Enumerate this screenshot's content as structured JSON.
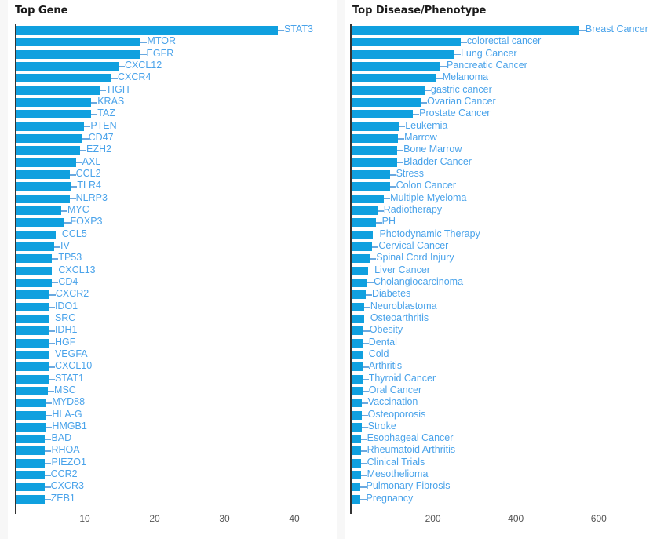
{
  "page": {
    "background": "#f7f7f7",
    "panel_background": "#ffffff",
    "bar_color": "#10a0df",
    "label_color": "#4aa3ea",
    "axis_color": "#333333",
    "tick_color": "#555555"
  },
  "panels": [
    {
      "title": "Top Gene"
    },
    {
      "title": "Top Disease/Phenotype"
    }
  ],
  "chart_data": [
    {
      "type": "bar",
      "title": "Top Gene",
      "orientation": "horizontal",
      "xlabel": "",
      "ylabel": "",
      "xlim": [
        0,
        42
      ],
      "xticks": [
        10,
        20,
        30,
        40
      ],
      "grid": false,
      "legend": "none",
      "categories": [
        "STAT3",
        "MTOR",
        "EGFR",
        "CXCL12",
        "CXCR4",
        "TIGIT",
        "KRAS",
        "TAZ",
        "PTEN",
        "CD47",
        "EZH2",
        "AXL",
        "CCL2",
        "TLR4",
        "NLRP3",
        "MYC",
        "FOXP3",
        "CCL5",
        "IV",
        "TP53",
        "CXCL13",
        "CD4",
        "CXCR2",
        "IDO1",
        "SRC",
        "IDH1",
        "HGF",
        "VEGFA",
        "CXCL10",
        "STAT1",
        "MSC",
        "MYD88",
        "HLA-G",
        "HMGB1",
        "BAD",
        "RHOA",
        "PIEZO1",
        "CCR2",
        "CXCR3",
        "ZEB1"
      ],
      "values": [
        37.4,
        17.8,
        17.7,
        14.6,
        13.6,
        11.9,
        10.7,
        10.7,
        9.7,
        9.4,
        9.1,
        8.5,
        7.6,
        7.8,
        7.6,
        6.4,
        6.8,
        5.6,
        5.4,
        5.1,
        5.1,
        5.1,
        4.7,
        4.6,
        4.6,
        4.6,
        4.6,
        4.6,
        4.6,
        4.6,
        4.5,
        4.2,
        4.2,
        4.2,
        4.1,
        4.1,
        4.1,
        4.0,
        4.0,
        4.0
      ]
    },
    {
      "type": "bar",
      "title": "Top Disease/Phenotype",
      "orientation": "horizontal",
      "xlabel": "",
      "ylabel": "",
      "xlim": [
        0,
        700
      ],
      "xticks": [
        200,
        400,
        600
      ],
      "grid": false,
      "legend": "none",
      "categories": [
        "Breast Cancer",
        "colorectal cancer",
        "Lung Cancer",
        "Pancreatic Cancer",
        "Melanoma",
        "gastric cancer",
        "Ovarian Cancer",
        "Prostate Cancer",
        "Leukemia",
        "Marrow",
        "Bone Marrow",
        "Bladder Cancer",
        "Stress",
        "Colon Cancer",
        "Multiple Myeloma",
        "Radiotherapy",
        "PH",
        "Photodynamic Therapy",
        "Cervical Cancer",
        "Spinal Cord Injury",
        "Liver Cancer",
        "Cholangiocarcinoma",
        "Diabetes",
        "Neuroblastoma",
        "Osteoarthritis",
        "Obesity",
        "Dental",
        "Cold",
        "Arthritis",
        "Thyroid Cancer",
        "Oral Cancer",
        "Vaccination",
        "Osteoporosis",
        "Stroke",
        "Esophageal Cancer",
        "Rheumatoid Arthritis",
        "Clinical Trials",
        "Mesothelioma",
        "Pulmonary Fibrosis",
        "Pregnancy"
      ],
      "values": [
        549,
        263,
        248,
        214,
        204,
        176,
        167,
        148,
        114,
        112,
        110,
        110,
        92,
        92,
        78,
        62,
        58,
        52,
        50,
        44,
        40,
        38,
        34,
        30,
        30,
        28,
        26,
        26,
        26,
        26,
        26,
        24,
        24,
        24,
        22,
        22,
        22,
        22,
        20,
        20
      ]
    }
  ]
}
